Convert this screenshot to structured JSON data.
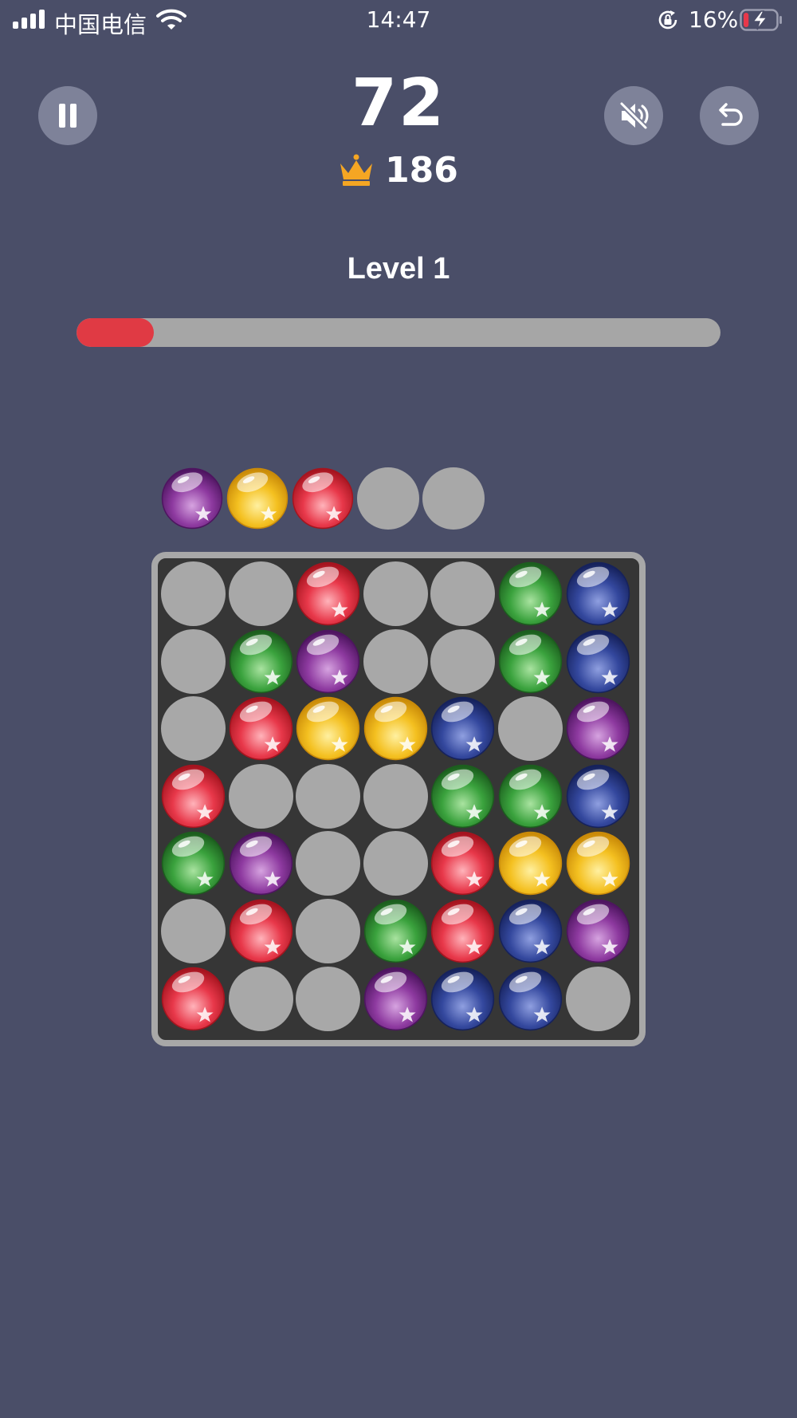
{
  "status_bar": {
    "carrier": "中国电信",
    "time": "14:47",
    "battery_percent": "16%",
    "battery_level": 0.16,
    "charging": true
  },
  "header": {
    "score": "72",
    "best_score": "186",
    "pause_icon": "pause-icon",
    "mute_icon": "speaker-muted-icon",
    "undo_icon": "undo-arrow-icon",
    "crown_icon": "crown-icon",
    "crown_color": "#f5a623"
  },
  "level": {
    "label": "Level 1",
    "progress": 0.12,
    "progress_color": "#e03a44"
  },
  "colors": {
    "R": {
      "name": "red",
      "light": "#ffb3ba",
      "base": "#e8384a",
      "dark": "#a5141f"
    },
    "G": {
      "name": "green",
      "light": "#a9e3a0",
      "base": "#3aa23d",
      "dark": "#1c5e1e"
    },
    "B": {
      "name": "blue",
      "light": "#8f9fe0",
      "base": "#34489e",
      "dark": "#16225c"
    },
    "P": {
      "name": "purple",
      "light": "#d6a3e0",
      "base": "#8e3aa0",
      "dark": "#4e1560"
    },
    "Y": {
      "name": "yellow",
      "light": "#fff0a0",
      "base": "#f4c020",
      "dark": "#c98a08"
    }
  },
  "next_balls": [
    "P",
    "Y",
    "R",
    "",
    ""
  ],
  "board": {
    "size": 7,
    "rows": [
      [
        "",
        "",
        "R",
        "",
        "",
        "G",
        "B"
      ],
      [
        "",
        "G",
        "P",
        "",
        "",
        "G",
        "B"
      ],
      [
        "",
        "R",
        "Y",
        "Y",
        "B",
        "",
        "P"
      ],
      [
        "R",
        "",
        "",
        "",
        "G",
        "G",
        "B"
      ],
      [
        "G",
        "P",
        "",
        "",
        "R",
        "Y",
        "Y"
      ],
      [
        "",
        "R",
        "",
        "G",
        "R",
        "B",
        "P"
      ],
      [
        "R",
        "",
        "",
        "P",
        "B",
        "B",
        ""
      ]
    ]
  }
}
